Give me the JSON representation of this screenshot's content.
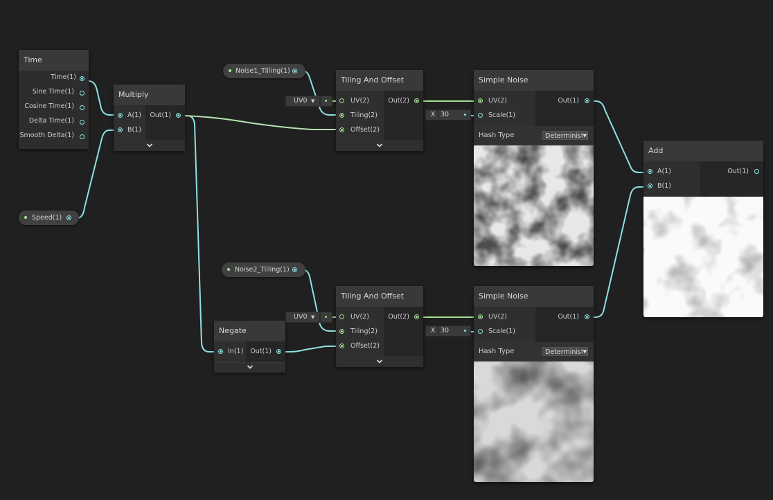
{
  "nodes": {
    "time": {
      "title": "Time",
      "outputs": [
        "Time(1)",
        "Sine Time(1)",
        "Cosine Time(1)",
        "Delta Time(1)",
        "Smooth Delta(1)"
      ]
    },
    "multiply": {
      "title": "Multiply",
      "inputs": [
        "A(1)",
        "B(1)"
      ],
      "output": "Out(1)"
    },
    "speed": {
      "label": "Speed(1)"
    },
    "noise1_tilling": {
      "label": "Noise1_Tilling(1)"
    },
    "noise2_tilling": {
      "label": "Noise2_Tilling(1)"
    },
    "tiling1": {
      "title": "Tiling And Offset",
      "inputs": [
        "UV(2)",
        "Tiling(2)",
        "Offset(2)"
      ],
      "output": "Out(2)",
      "uv_value": "UV0"
    },
    "tiling2": {
      "title": "Tiling And Offset",
      "inputs": [
        "UV(2)",
        "Tiling(2)",
        "Offset(2)"
      ],
      "output": "Out(2)",
      "uv_value": "UV0"
    },
    "negate": {
      "title": "Negate",
      "input": "In(1)",
      "output": "Out(1)"
    },
    "noise1": {
      "title": "Simple Noise",
      "inputs": [
        "UV(2)",
        "Scale(1)"
      ],
      "output": "Out(1)",
      "hash_label": "Hash Type",
      "hash_value": "Deterministic",
      "scale_axis": "X",
      "scale_value": "30"
    },
    "noise2": {
      "title": "Simple Noise",
      "inputs": [
        "UV(2)",
        "Scale(1)"
      ],
      "output": "Out(1)",
      "hash_label": "Hash Type",
      "hash_value": "Deterministic",
      "scale_axis": "X",
      "scale_value": "30"
    },
    "add": {
      "title": "Add",
      "inputs": [
        "A(1)",
        "B(1)"
      ],
      "output": "Out(1)"
    }
  },
  "icons": {
    "expand": "chevron-down-icon",
    "dropdown": "triangle-down-icon"
  },
  "colors": {
    "float_port": "#8fe1e1",
    "vector2_port": "#9fe38f",
    "background": "#202020"
  }
}
